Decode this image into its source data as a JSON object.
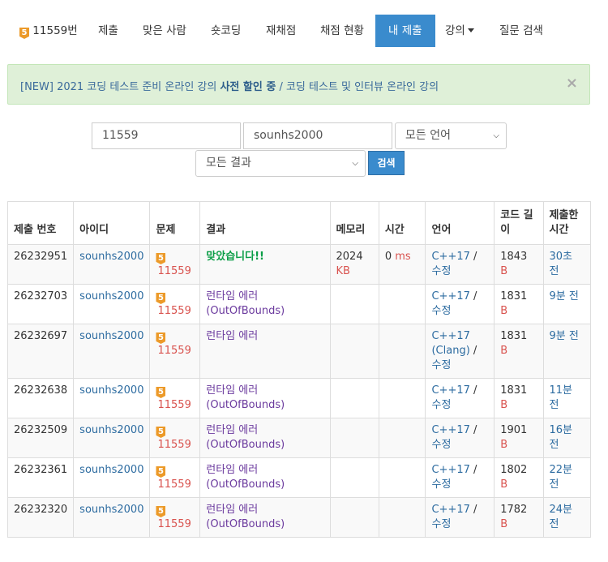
{
  "nav": {
    "problem_label": "11559번",
    "problem_level": "5",
    "items": [
      "제출",
      "맞은 사람",
      "숏코딩",
      "재채점",
      "채점 현황",
      "내 제출",
      "강의",
      "질문 검색"
    ]
  },
  "alert": {
    "part1": "[NEW] 2021 코딩 테스트 준비 온라인 강의 ",
    "bold": "사전 할인 중",
    "part2": " / 코딩 테스트 및 인터뷰 온라인 강의",
    "close": "×"
  },
  "search": {
    "problem_id": "11559",
    "user_id": "sounhs2000",
    "language": "모든 언어",
    "result": "모든 결과",
    "button": "검색"
  },
  "table": {
    "headers": [
      "제출 번호",
      "아이디",
      "문제",
      "결과",
      "메모리",
      "시간",
      "언어",
      "코드 길이",
      "제출한 시간"
    ],
    "rows": [
      {
        "id": "26232951",
        "user": "sounhs2000",
        "problem": "11559",
        "result": "맞았습니다!!",
        "memory": "2024",
        "memory_unit": "KB",
        "time": "0",
        "time_unit": "ms",
        "lang": "C++17",
        "edit": "수정",
        "code_len": "1843",
        "code_unit": "B",
        "submitted": "30초 전"
      },
      {
        "id": "26232703",
        "user": "sounhs2000",
        "problem": "11559",
        "result": "런타임 에러 (OutOfBounds)",
        "memory": "",
        "memory_unit": "",
        "time": "",
        "time_unit": "",
        "lang": "C++17",
        "edit": "수정",
        "code_len": "1831",
        "code_unit": "B",
        "submitted": "9분 전"
      },
      {
        "id": "26232697",
        "user": "sounhs2000",
        "problem": "11559",
        "result": "런타임 에러",
        "memory": "",
        "memory_unit": "",
        "time": "",
        "time_unit": "",
        "lang": "C++17 (Clang)",
        "edit": "수정",
        "code_len": "1831",
        "code_unit": "B",
        "submitted": "9분 전"
      },
      {
        "id": "26232638",
        "user": "sounhs2000",
        "problem": "11559",
        "result": "런타임 에러 (OutOfBounds)",
        "memory": "",
        "memory_unit": "",
        "time": "",
        "time_unit": "",
        "lang": "C++17",
        "edit": "수정",
        "code_len": "1831",
        "code_unit": "B",
        "submitted": "11분 전"
      },
      {
        "id": "26232509",
        "user": "sounhs2000",
        "problem": "11559",
        "result": "런타임 에러 (OutOfBounds)",
        "memory": "",
        "memory_unit": "",
        "time": "",
        "time_unit": "",
        "lang": "C++17",
        "edit": "수정",
        "code_len": "1901",
        "code_unit": "B",
        "submitted": "16분 전"
      },
      {
        "id": "26232361",
        "user": "sounhs2000",
        "problem": "11559",
        "result": "런타임 에러 (OutOfBounds)",
        "memory": "",
        "memory_unit": "",
        "time": "",
        "time_unit": "",
        "lang": "C++17",
        "edit": "수정",
        "code_len": "1802",
        "code_unit": "B",
        "submitted": "22분 전"
      },
      {
        "id": "26232320",
        "user": "sounhs2000",
        "problem": "11559",
        "result": "런타임 에러 (OutOfBounds)",
        "memory": "",
        "memory_unit": "",
        "time": "",
        "time_unit": "",
        "lang": "C++17",
        "edit": "수정",
        "code_len": "1782",
        "code_unit": "B",
        "submitted": "24분 전"
      }
    ]
  }
}
